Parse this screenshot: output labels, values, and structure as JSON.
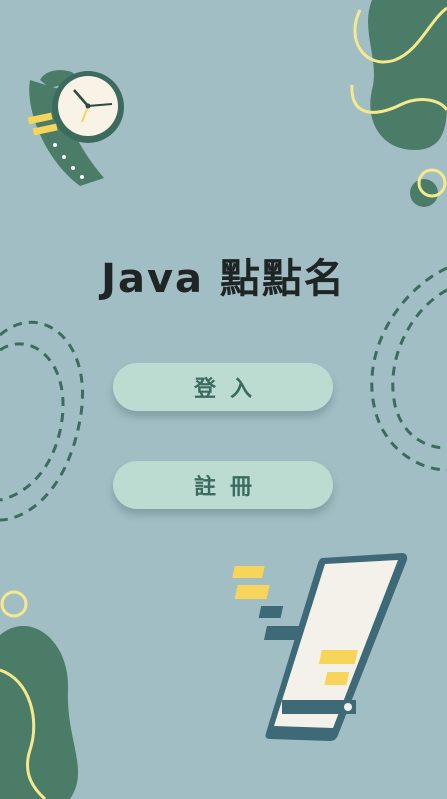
{
  "app": {
    "title": "Java 點點名"
  },
  "buttons": {
    "login_label": "登入",
    "register_label": "註冊"
  },
  "colors": {
    "background": "#a1bec4",
    "button": "#bcdcd1",
    "button_text": "#3b6a5f",
    "dark_green": "#4b7c68",
    "accent_yellow": "#f6e98b"
  },
  "illustrations": [
    "watch-icon",
    "phone-chat-icon",
    "blob-decoration",
    "dashed-line-decoration"
  ]
}
